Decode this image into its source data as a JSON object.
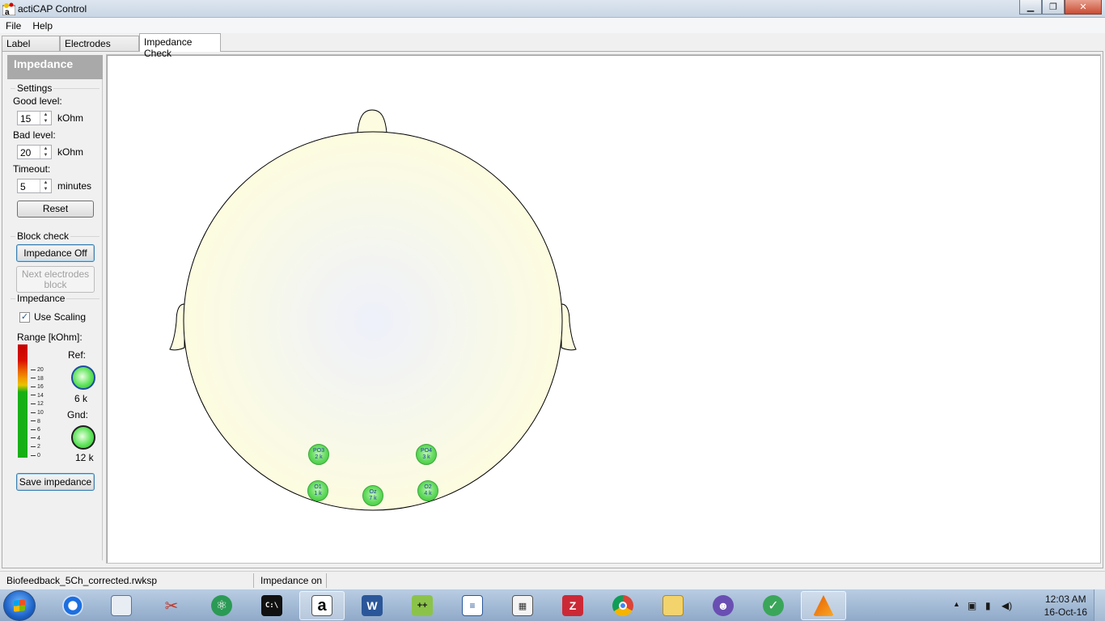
{
  "window": {
    "title": "actiCAP Control",
    "icon": "acticap-app-icon",
    "minimize": "▁",
    "maximize": "❐",
    "close": "✕"
  },
  "menu": {
    "items": [
      "File",
      "Help"
    ]
  },
  "tabs": [
    {
      "label": "Label Check",
      "active": false
    },
    {
      "label": "Electrodes Groups",
      "active": false
    },
    {
      "label": "Impedance Check",
      "active": true
    }
  ],
  "panel": {
    "title": "Impedance",
    "settings": {
      "group_title": "Settings",
      "good_label": "Good level:",
      "good_value": "15",
      "good_unit": "kOhm",
      "bad_label": "Bad level:",
      "bad_value": "20",
      "bad_unit": "kOhm",
      "timeout_label": "Timeout:",
      "timeout_value": "5",
      "timeout_unit": "minutes",
      "reset_label": "Reset"
    },
    "block_check": {
      "group_title": "Block check",
      "impedance_off_label": "Impedance Off",
      "next_block_label_1": "Next electrodes",
      "next_block_label_2": "block"
    },
    "impedance": {
      "group_title": "Impedance",
      "use_scaling_label": "Use Scaling",
      "use_scaling_checked": true,
      "range_label": "Range [kOhm]:",
      "scale_ticks": [
        "20",
        "18",
        "16",
        "14",
        "12",
        "10",
        "8",
        "6",
        "4",
        "2",
        "0"
      ],
      "ref_label": "Ref:",
      "ref_value": "6 k",
      "gnd_label": "Gnd:",
      "gnd_value": "12 k",
      "save_label": "Save impedance"
    }
  },
  "electrodes": [
    {
      "name": "PO3",
      "value": "2 k"
    },
    {
      "name": "PO4",
      "value": "3 k"
    },
    {
      "name": "O1",
      "value": "1 k"
    },
    {
      "name": "Oz",
      "value": "7 k"
    },
    {
      "name": "O2",
      "value": "4 k"
    }
  ],
  "status": {
    "workspace": "Biofeedback_5Ch_corrected.rwksp",
    "state": "Impedance on"
  },
  "taskbar": {
    "apps": [
      "start-orb",
      "teamviewer-icon",
      "explorer-window-icon",
      "scissors-tool-icon",
      "atom-icon",
      "cmd-icon",
      "acticap-icon",
      "word-icon",
      "notepad-plus-icon",
      "document-icon",
      "calculator-icon",
      "zotero-icon",
      "chrome-icon",
      "file-explorer-icon",
      "cat-app-icon",
      "green-check-icon",
      "matlab-icon"
    ],
    "active_app": "acticap-icon",
    "time": "12:03 AM",
    "date": "16-Oct-16",
    "tray_arrow": "▲"
  },
  "colors": {
    "scale_top": "#c40000",
    "scale_mid": "#f09a00",
    "scale_low": "#16b016",
    "electrode_good": "#5fd95a",
    "head_fill": "#fdfce0"
  }
}
